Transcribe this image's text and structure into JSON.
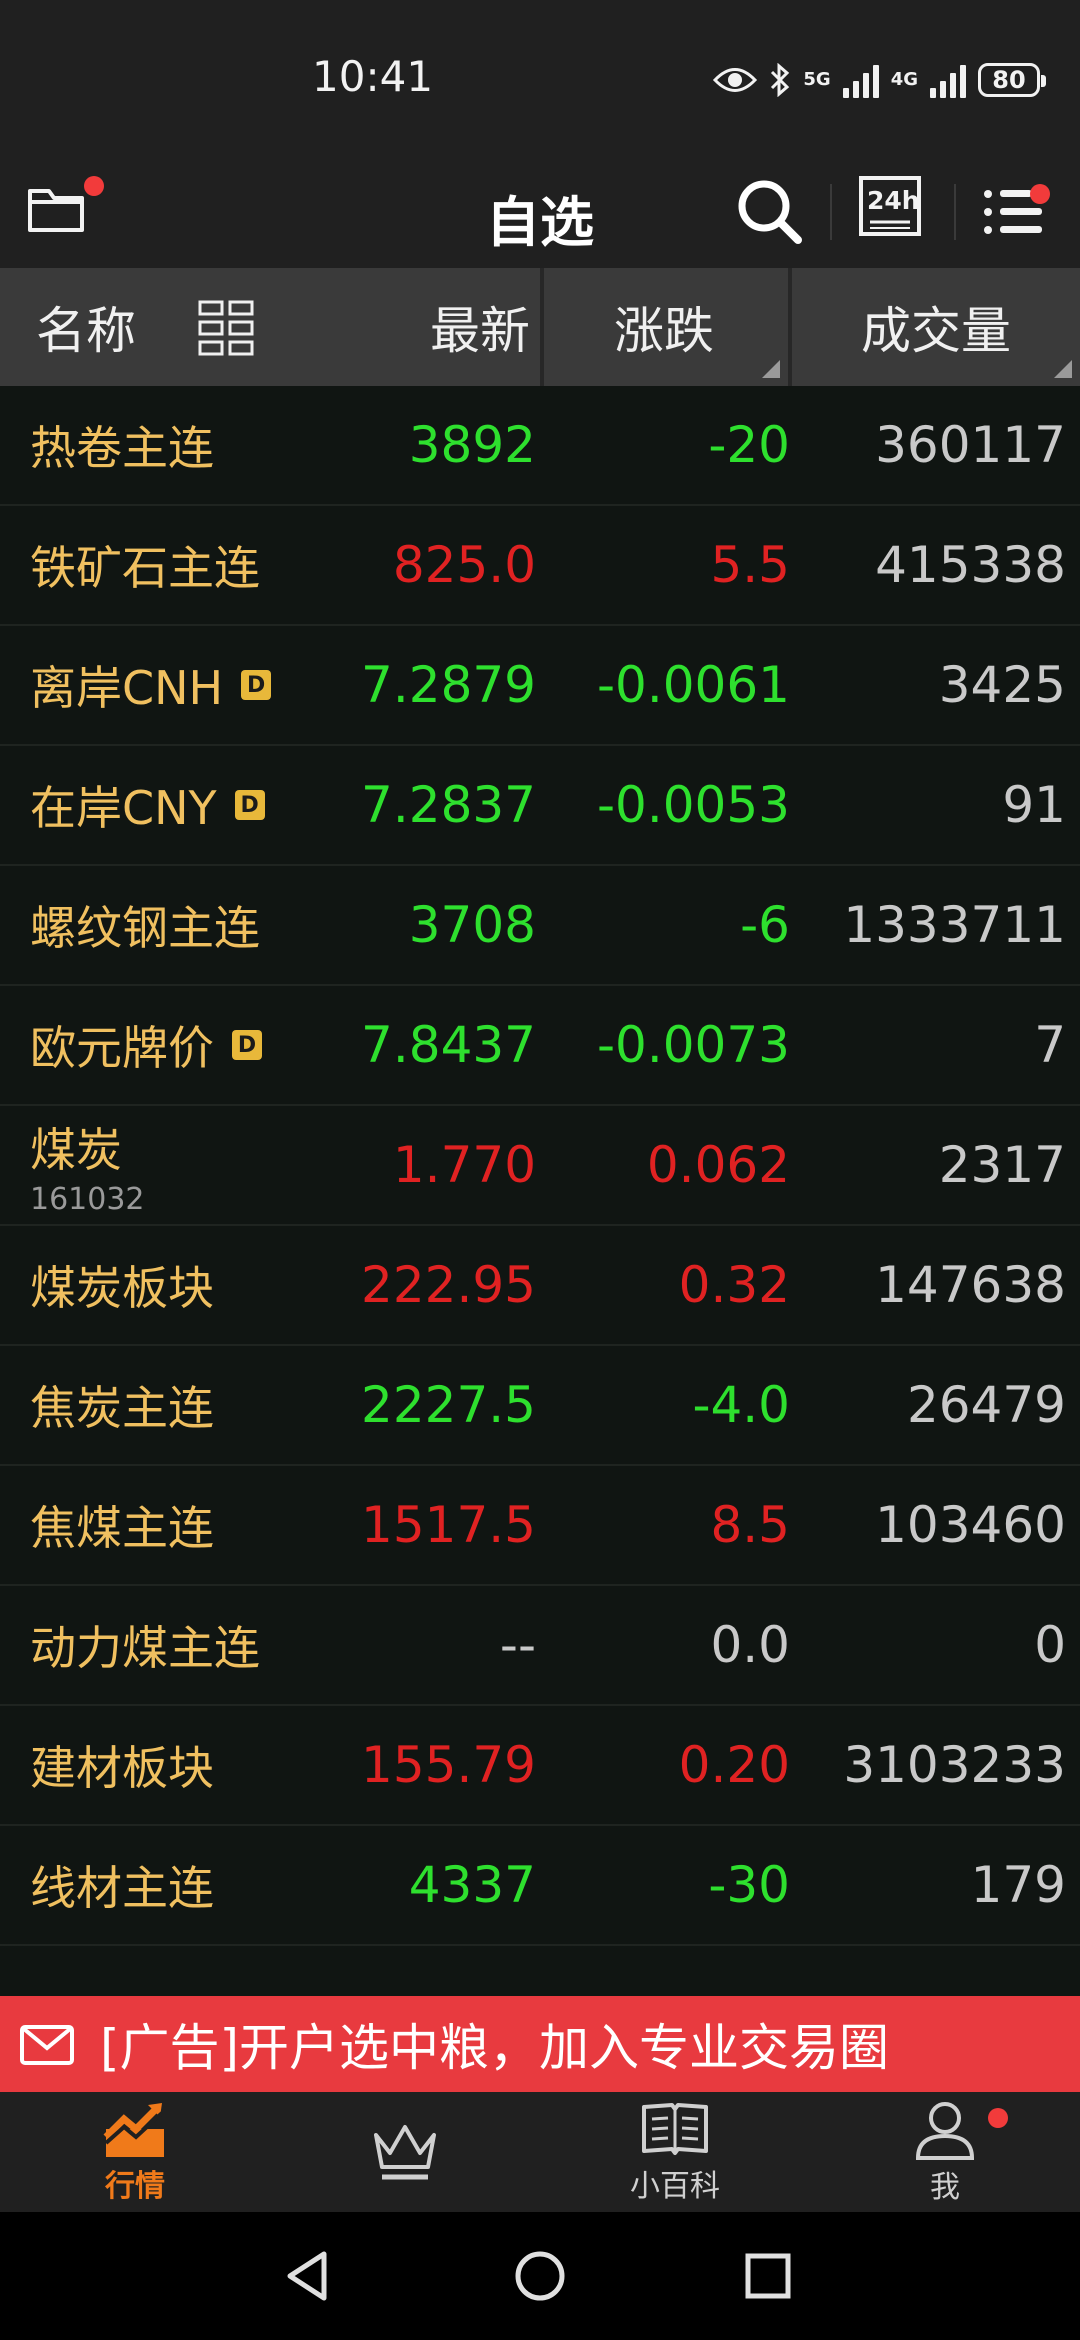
{
  "status": {
    "time": "10:41",
    "net_5g_top": "5G",
    "net_5g_bottom": "4G",
    "net_4g_top": "4G",
    "net_4g_bottom": "",
    "battery": "80"
  },
  "header": {
    "title": "自选",
    "icons": [
      "folder-icon",
      "search-icon",
      "24h-icon",
      "list-menu-icon"
    ],
    "btn24h_label": "24h"
  },
  "columns": {
    "name": "名称",
    "latest": "最新",
    "change": "涨跌",
    "volume": "成交量"
  },
  "rows": [
    {
      "name": "热卷主连",
      "code": "",
      "badge": "",
      "latest": "3892",
      "change": "-20",
      "volume": "360117",
      "trend": "down"
    },
    {
      "name": "铁矿石主连",
      "code": "",
      "badge": "",
      "latest": "825.0",
      "change": "5.5",
      "volume": "415338",
      "trend": "up"
    },
    {
      "name": "离岸CNH",
      "code": "",
      "badge": "D",
      "latest": "7.2879",
      "change": "-0.0061",
      "volume": "3425",
      "trend": "down"
    },
    {
      "name": "在岸CNY",
      "code": "",
      "badge": "D",
      "latest": "7.2837",
      "change": "-0.0053",
      "volume": "91",
      "trend": "down"
    },
    {
      "name": "螺纹钢主连",
      "code": "",
      "badge": "",
      "latest": "3708",
      "change": "-6",
      "volume": "1333711",
      "trend": "down"
    },
    {
      "name": "欧元牌价",
      "code": "",
      "badge": "D",
      "latest": "7.8437",
      "change": "-0.0073",
      "volume": "7",
      "trend": "down"
    },
    {
      "name": "煤炭",
      "code": "161032",
      "badge": "",
      "latest": "1.770",
      "change": "0.062",
      "volume": "2317",
      "trend": "up"
    },
    {
      "name": "煤炭板块",
      "code": "",
      "badge": "",
      "latest": "222.95",
      "change": "0.32",
      "volume": "147638",
      "trend": "up"
    },
    {
      "name": "焦炭主连",
      "code": "",
      "badge": "",
      "latest": "2227.5",
      "change": "-4.0",
      "volume": "26479",
      "trend": "down"
    },
    {
      "name": "焦煤主连",
      "code": "",
      "badge": "",
      "latest": "1517.5",
      "change": "8.5",
      "volume": "103460",
      "trend": "up"
    },
    {
      "name": "动力煤主连",
      "code": "",
      "badge": "",
      "latest": "--",
      "change": "0.0",
      "volume": "0",
      "trend": "flat"
    },
    {
      "name": "建材板块",
      "code": "",
      "badge": "",
      "latest": "155.79",
      "change": "0.20",
      "volume": "3103233",
      "trend": "up"
    },
    {
      "name": "线材主连",
      "code": "",
      "badge": "",
      "latest": "4337",
      "change": "-30",
      "volume": "179",
      "trend": "down"
    }
  ],
  "ad": {
    "text": "[广告]开户选中粮，加入专业交易圈"
  },
  "tabs": [
    {
      "label": "行情",
      "icon": "market-chart-icon",
      "active": true
    },
    {
      "label": "",
      "icon": "crown-icon",
      "active": false
    },
    {
      "label": "小百科",
      "icon": "book-icon",
      "active": false
    },
    {
      "label": "我",
      "icon": "user-icon",
      "active": false
    }
  ],
  "colors": {
    "up": "#e02222",
    "down": "#2ee02e",
    "name": "#f0c060",
    "accent": "#f07a1a",
    "ad_bg": "#e83a3f"
  }
}
